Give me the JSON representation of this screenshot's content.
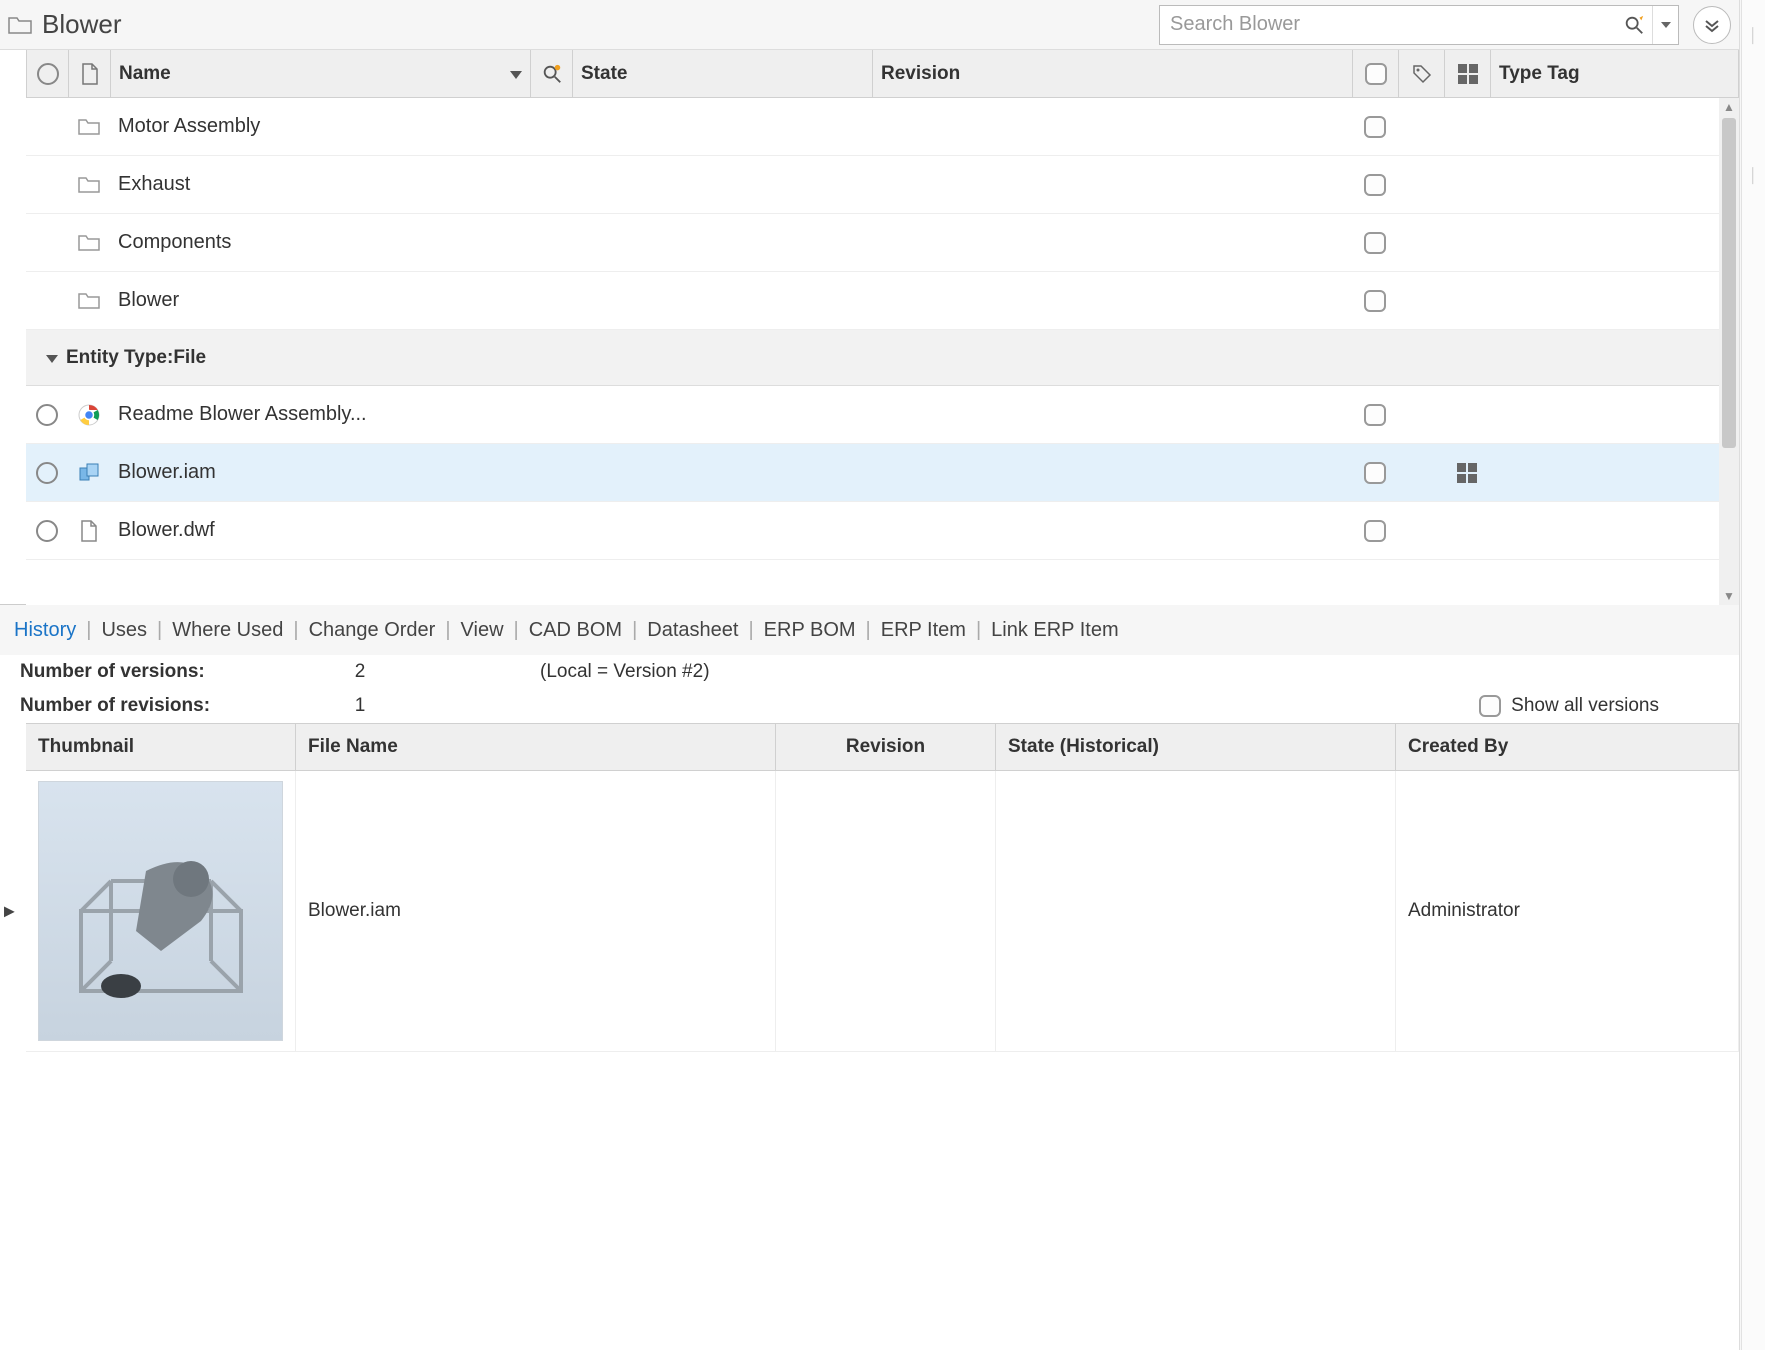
{
  "titlebar": {
    "title": "Blower",
    "search_placeholder": "Search Blower"
  },
  "grid": {
    "columns": {
      "name": "Name",
      "state": "State",
      "revision": "Revision",
      "type_tag": "Type Tag"
    },
    "group_label": "Entity Type:File",
    "folders": [
      {
        "name": "Motor Assembly"
      },
      {
        "name": "Exhaust"
      },
      {
        "name": "Components"
      },
      {
        "name": "Blower"
      }
    ],
    "files": [
      {
        "name": "Readme Blower Assembly...",
        "icon": "chrome",
        "has_grid": false
      },
      {
        "name": "Blower.iam",
        "icon": "asm",
        "has_grid": true,
        "selected": true
      },
      {
        "name": "Blower.dwf",
        "icon": "page",
        "has_grid": false
      }
    ]
  },
  "detail": {
    "tabs": [
      "History",
      "Uses",
      "Where Used",
      "Change Order",
      "View",
      "CAD BOM",
      "Datasheet",
      "ERP BOM",
      "ERP Item",
      "Link ERP Item"
    ],
    "active_tab_index": 0,
    "versions_label": "Number of versions:",
    "versions_value": "2",
    "versions_note": "(Local = Version #2)",
    "revisions_label": "Number of revisions:",
    "revisions_value": "1",
    "show_all_label": "Show all versions",
    "history_columns": {
      "thumbnail": "Thumbnail",
      "file_name": "File Name",
      "revision": "Revision",
      "state_hist": "State (Historical)",
      "created_by": "Created By"
    },
    "history_rows": [
      {
        "file_name": "Blower.iam",
        "revision": "",
        "state": "",
        "created_by": "Administrator"
      }
    ]
  }
}
